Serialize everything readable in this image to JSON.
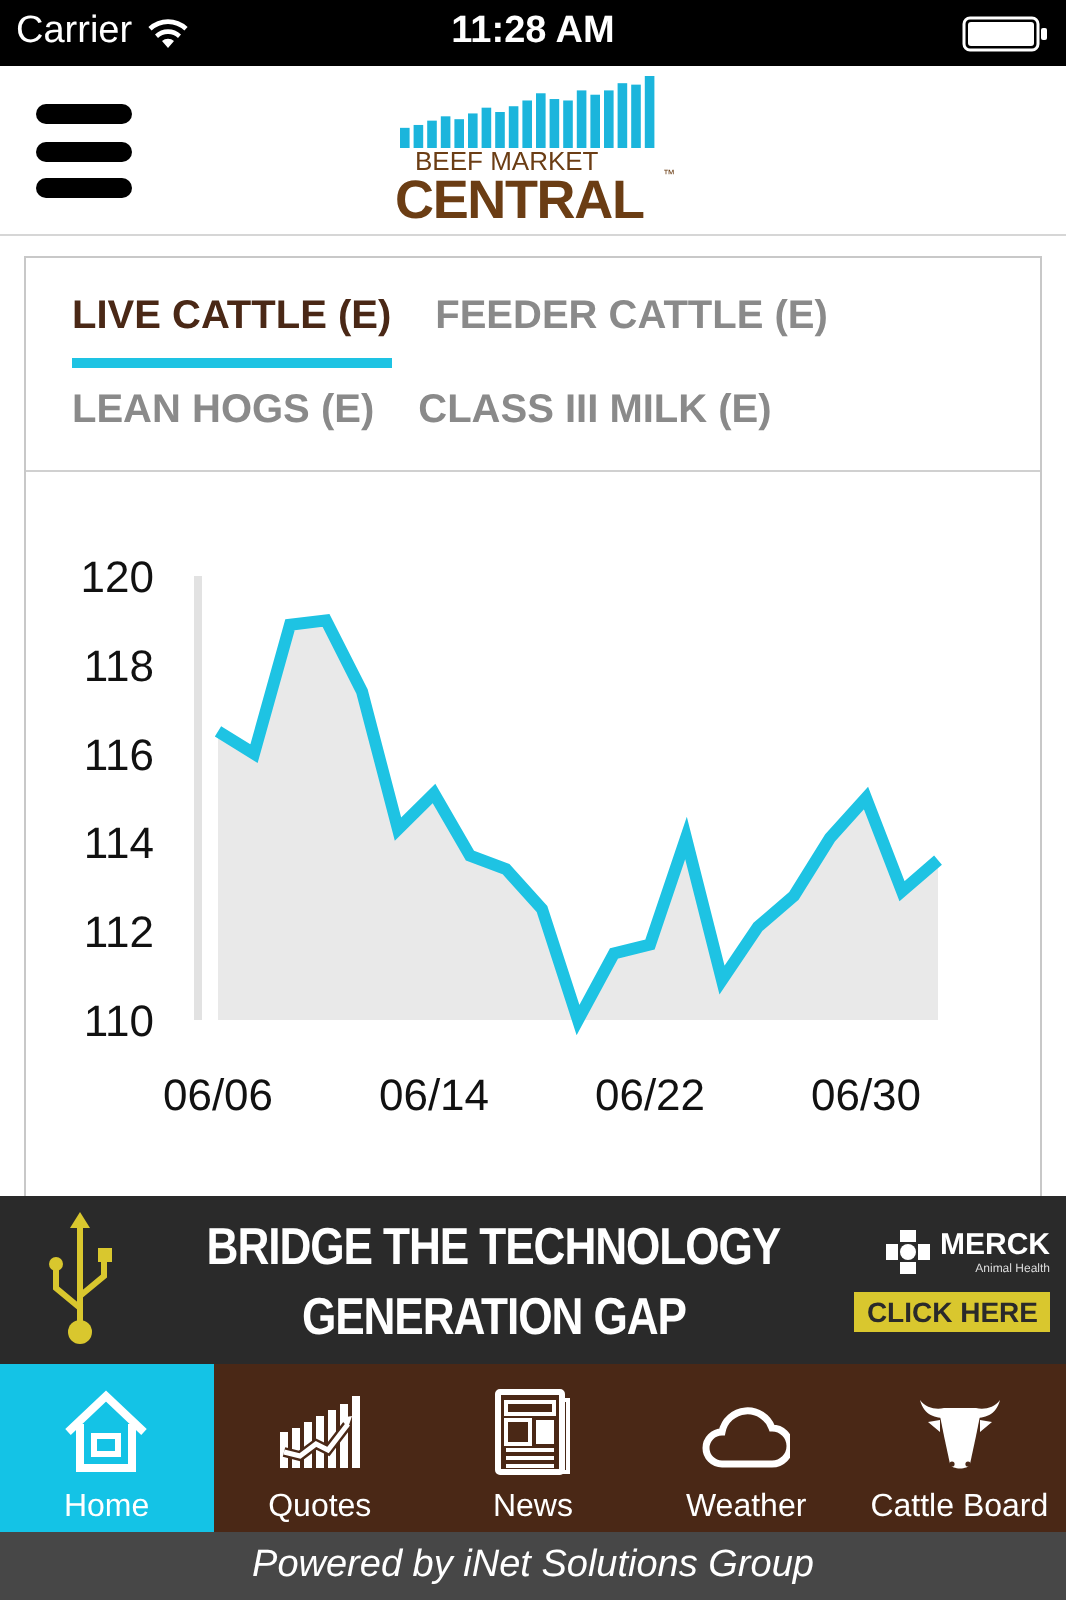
{
  "status_bar": {
    "carrier": "Carrier",
    "time": "11:28 AM"
  },
  "logo": {
    "line_1": "BEEF MARKET",
    "line_2": "CENTRAL",
    "mark": "™"
  },
  "tabs": [
    {
      "label": "LIVE CATTLE (E)",
      "selected": true
    },
    {
      "label": "FEEDER CATTLE (E)",
      "selected": false
    },
    {
      "label": "LEAN HOGS (E)",
      "selected": false
    },
    {
      "label": "CLASS III MILK (E)",
      "selected": false
    }
  ],
  "chart_data": {
    "type": "area",
    "categories": [
      "06/06",
      null,
      null,
      null,
      null,
      null,
      "06/14",
      null,
      null,
      null,
      null,
      null,
      "06/22",
      null,
      null,
      null,
      null,
      null,
      "06/30",
      null,
      null
    ],
    "series": [
      {
        "color": "#1ec3e3",
        "values": [
          116.5,
          116.0,
          118.9,
          119.0,
          117.4,
          114.3,
          115.1,
          113.7,
          113.4,
          112.5,
          110.0,
          111.5,
          111.7,
          114.1,
          110.9,
          112.1,
          112.8,
          114.1,
          115.0,
          112.9,
          113.6
        ]
      }
    ],
    "ylim": [
      110,
      120
    ],
    "yticks": [
      110,
      112,
      114,
      116,
      118,
      120
    ]
  },
  "ad": {
    "headline_1": "BRIDGE THE TECHNOLOGY",
    "headline_2": "GENERATION GAP",
    "brand": "MERCK",
    "brand_sub": "Animal Health",
    "button": "CLICK HERE"
  },
  "nav": [
    {
      "kind": "home",
      "label": "Home",
      "selected": true
    },
    {
      "kind": "quotes",
      "label": "Quotes",
      "selected": false
    },
    {
      "kind": "news",
      "label": "News",
      "selected": false
    },
    {
      "kind": "weather",
      "label": "Weather",
      "selected": false
    },
    {
      "kind": "cattle",
      "label": "Cattle Board",
      "selected": false
    }
  ],
  "footer": "Powered by iNet Solutions Group"
}
